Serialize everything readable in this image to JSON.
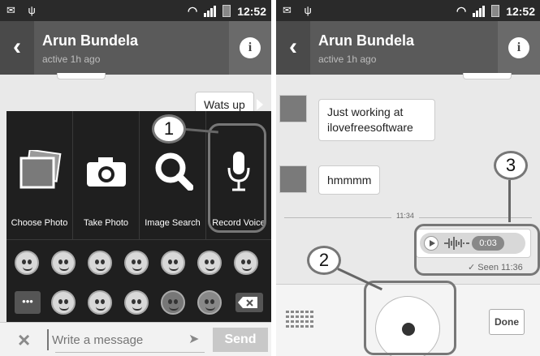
{
  "status": {
    "time": "12:52"
  },
  "header": {
    "back": "‹",
    "name": "Arun Bundela",
    "subtitle": "active 1h ago",
    "info": "i"
  },
  "left": {
    "message_out": "Wats up",
    "attachments": [
      {
        "label": "Choose Photo",
        "icon": "photos-icon"
      },
      {
        "label": "Take Photo",
        "icon": "camera-icon"
      },
      {
        "label": "Image Search",
        "icon": "magnifier-icon"
      },
      {
        "label": "Record Voice",
        "icon": "microphone-icon"
      }
    ],
    "more_label": "•••",
    "input_placeholder": "Write a message",
    "send_label": "Send",
    "annotation": "1"
  },
  "right": {
    "messages": [
      "Just working at ilovefreesoftware",
      "hmmmm"
    ],
    "divider_time": "11:34",
    "voice_duration": "0:03",
    "seen": "Seen 11:36",
    "done_label": "Done",
    "annotation_record": "2",
    "annotation_voice": "3"
  }
}
